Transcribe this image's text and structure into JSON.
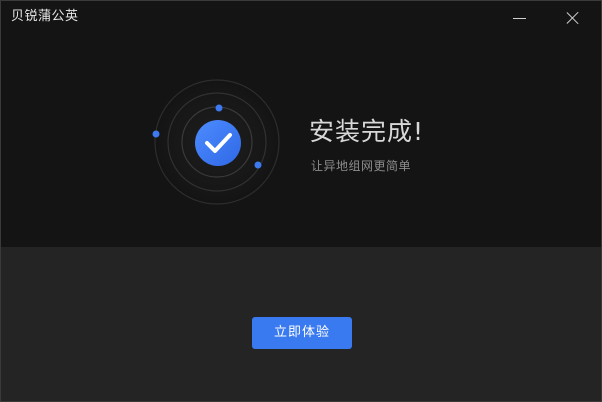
{
  "window": {
    "title": "贝锐蒲公英"
  },
  "status": {
    "title": "安装完成!",
    "subtitle": "让异地组网更简单"
  },
  "actions": {
    "primary_label": "立即体验"
  },
  "colors": {
    "accent": "#3a7af0",
    "top_background": "#141414",
    "bottom_background": "#242424"
  },
  "icons": {
    "minimize": "minimize-icon",
    "close": "close-icon",
    "success": "check-circle-icon"
  }
}
